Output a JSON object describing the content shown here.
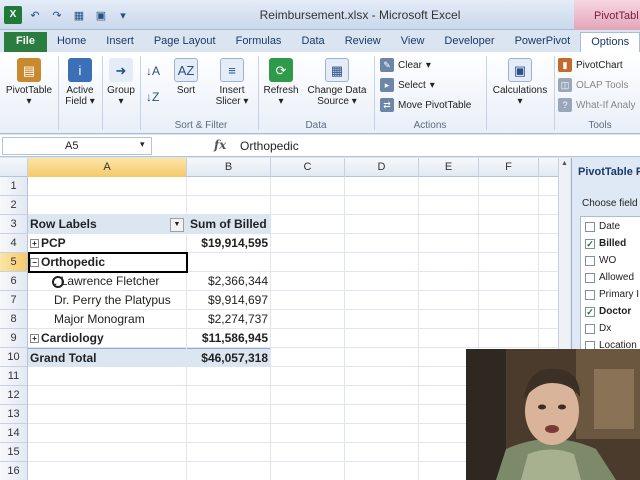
{
  "window": {
    "title": "Reimbursement.xlsx - Microsoft Excel",
    "context_tab": "PivotTabl"
  },
  "tabs": [
    "File",
    "Home",
    "Insert",
    "Page Layout",
    "Formulas",
    "Data",
    "Review",
    "View",
    "Developer",
    "PowerPivot",
    "Options"
  ],
  "ribbon": {
    "pivottable": "PivotTable",
    "active_field_1": "Active",
    "active_field_2": "Field",
    "group": "Group",
    "sort_btn": "Sort",
    "insert_slicer_1": "Insert",
    "insert_slicer_2": "Slicer",
    "refresh": "Refresh",
    "change_source_1": "Change Data",
    "change_source_2": "Source",
    "clear": "Clear",
    "select": "Select",
    "move_pivot": "Move PivotTable",
    "calculations": "Calculations",
    "pivotchart": "PivotChart",
    "olap_tools": "OLAP Tools",
    "what_if": "What-If Analy",
    "group_sort_filter": "Sort & Filter",
    "group_data": "Data",
    "group_actions": "Actions",
    "group_tools": "Tools"
  },
  "formula_bar": {
    "name_box": "A5",
    "fx": "fx",
    "value": "Orthopedic"
  },
  "columns": [
    "A",
    "B",
    "C",
    "D",
    "E",
    "F"
  ],
  "rows": [
    "1",
    "2",
    "3",
    "4",
    "5",
    "6",
    "7",
    "8",
    "9",
    "10",
    "11",
    "12",
    "13",
    "14",
    "15",
    "16"
  ],
  "pivot": {
    "header_label": "Row Labels",
    "header_value": "Sum of Billed",
    "pcp_label": "PCP",
    "pcp_value": "$19,914,595",
    "ortho_label": "Orthopedic",
    "doc1_label": ". Lawrence Fletcher",
    "doc1_value": "$2,366,344",
    "doc2_label": "Dr. Perry the Platypus",
    "doc2_value": "$9,914,697",
    "doc3_label": "Major Monogram",
    "doc3_value": "$2,274,737",
    "cardio_label": "Cardiology",
    "cardio_value": "$11,586,945",
    "total_label": "Grand Total",
    "total_value": "$46,057,318"
  },
  "pivot_pane": {
    "title": "PivotTable F",
    "choose": "Choose field",
    "fields": [
      {
        "name": "Date",
        "checked": false
      },
      {
        "name": "Billed",
        "checked": true
      },
      {
        "name": "WO",
        "checked": false
      },
      {
        "name": "Allowed",
        "checked": false
      },
      {
        "name": "Primary I",
        "checked": false
      },
      {
        "name": "Doctor",
        "checked": true
      },
      {
        "name": "Dx",
        "checked": false
      },
      {
        "name": "Location",
        "checked": false
      }
    ]
  },
  "glyphs": {
    "plus": "+",
    "minus": "−",
    "check": "✓"
  },
  "colors": {
    "file_tab": "#2a7d3e",
    "pivot_header": "#dce6f1",
    "context_tab": "#e3a6bc"
  }
}
